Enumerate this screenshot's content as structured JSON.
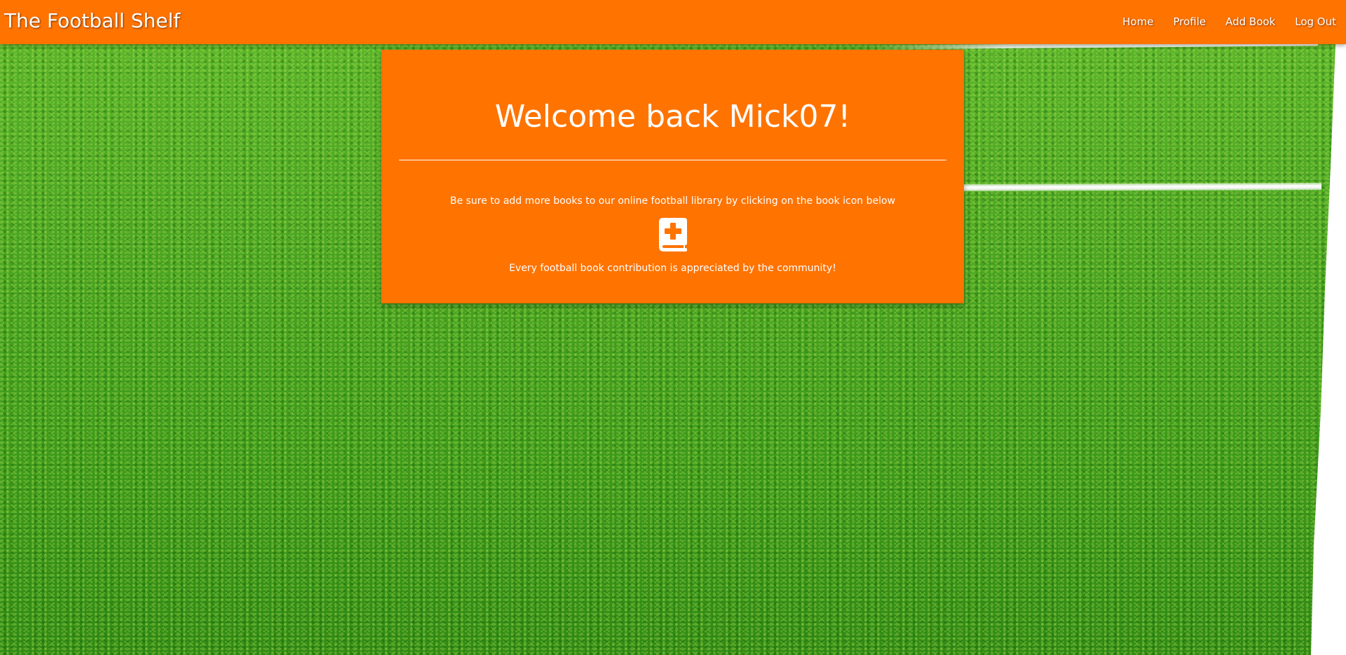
{
  "navbar": {
    "brand": "The Football Shelf",
    "links": [
      {
        "label": "Home"
      },
      {
        "label": "Profile"
      },
      {
        "label": "Add Book"
      },
      {
        "label": "Log Out"
      }
    ]
  },
  "card": {
    "heading": "Welcome back Mick07!",
    "message": "Be sure to add more books to our online football library by clicking on the book icon below",
    "icon": "book-medical-icon",
    "thanks": "Every football book contribution is appreciated by the community!"
  },
  "colors": {
    "accent": "#ff7300",
    "text": "#ffffff",
    "background": "#4aa622"
  }
}
